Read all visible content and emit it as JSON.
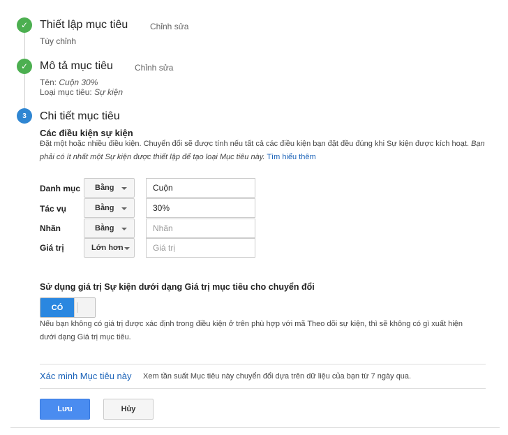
{
  "steps": [
    {
      "number": "",
      "title": "Thiết lập mục tiêu",
      "edit_label": "Chỉnh sửa",
      "summary": "Tùy chỉnh"
    },
    {
      "number": "",
      "title": "Mô tả mục tiêu",
      "edit_label": "Chỉnh sửa",
      "name_label": "Tên:",
      "name_value": "Cuộn 30%",
      "type_label": "Loại mục tiêu:",
      "type_value": "Sự kiện"
    },
    {
      "number": "3",
      "title": "Chi tiết mục tiêu"
    }
  ],
  "event_conditions": {
    "heading": "Các điều kiện sự kiện",
    "description": "Đặt một hoặc nhiều điều kiện. Chuyển đổi sẽ được tính nếu tất cả các điều kiện bạn đặt đều đúng khi Sự kiện được kích hoạt.",
    "note": "Bạn phải có ít nhất một Sự kiện được thiết lập để tạo loại Mục tiêu này.",
    "learn_more": "Tìm hiểu thêm",
    "rows": [
      {
        "label": "Danh mục",
        "operator": "Bằng",
        "value": "Cuộn",
        "placeholder": ""
      },
      {
        "label": "Tác vụ",
        "operator": "Bằng",
        "value": "30%",
        "placeholder": ""
      },
      {
        "label": "Nhãn",
        "operator": "Bằng",
        "value": "",
        "placeholder": "Nhãn"
      },
      {
        "label": "Giá trị",
        "operator": "Lớn hơn",
        "value": "",
        "placeholder": "Giá trị"
      }
    ]
  },
  "use_value": {
    "label": "Sử dụng giá trị Sự kiện dưới dạng Giá trị mục tiêu cho chuyển đổi",
    "toggle_on_label": "CÓ",
    "help": "Nếu bạn không có giá trị được xác định trong điều kiện ở trên phù hợp với mã Theo dõi sự kiện, thì sẽ không có gì xuất hiện dưới dạng Giá trị mục tiêu."
  },
  "verify": {
    "link": "Xác minh Mục tiêu này",
    "text": "Xem tần suất Mục tiêu này chuyển đổi dựa trên dữ liệu của bạn từ 7 ngày qua."
  },
  "buttons": {
    "save": "Lưu",
    "cancel": "Hủy"
  },
  "colors": {
    "done": "#4caf50",
    "current": "#2f86d2",
    "toggle": "#2a87e0",
    "save": "#4a8cf0",
    "link": "#1a62b8"
  }
}
